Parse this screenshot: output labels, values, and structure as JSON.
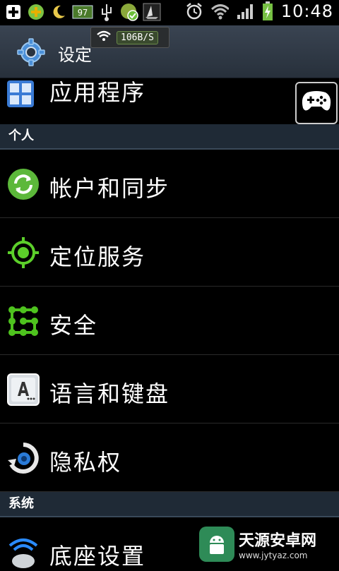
{
  "status_bar": {
    "left_icons": [
      "add-icon",
      "plus-circle-icon",
      "moon-icon",
      "battery-badge-icon",
      "usb-icon",
      "shield-check-icon",
      "ship-icon"
    ],
    "badge_text": "97",
    "right_icons": [
      "alarm-icon",
      "wifi-icon",
      "signal-icon",
      "battery-charging-icon"
    ],
    "time": "10:48"
  },
  "net_speed": {
    "value": "106B/S"
  },
  "header": {
    "title": "设定"
  },
  "partial_item": {
    "label": "应用程序",
    "icon": "apps-grid-icon"
  },
  "sections": {
    "personal": "个人",
    "system": "系统"
  },
  "personal_items": [
    {
      "label": "帐户和同步",
      "icon": "sync-icon"
    },
    {
      "label": "定位服务",
      "icon": "location-target-icon"
    },
    {
      "label": "安全",
      "icon": "security-icon"
    },
    {
      "label": "语言和键盘",
      "icon": "keyboard-key-icon"
    },
    {
      "label": "隐私权",
      "icon": "privacy-icon"
    }
  ],
  "system_items": [
    {
      "label": "底座设置",
      "icon": "dock-icon"
    }
  ],
  "watermark": {
    "name": "天源安卓网",
    "url": "www.jytyaz.com"
  },
  "colors": {
    "header_top": "#3a4452",
    "section_bg": "#1f2a36",
    "accent_green": "#4caf50"
  }
}
